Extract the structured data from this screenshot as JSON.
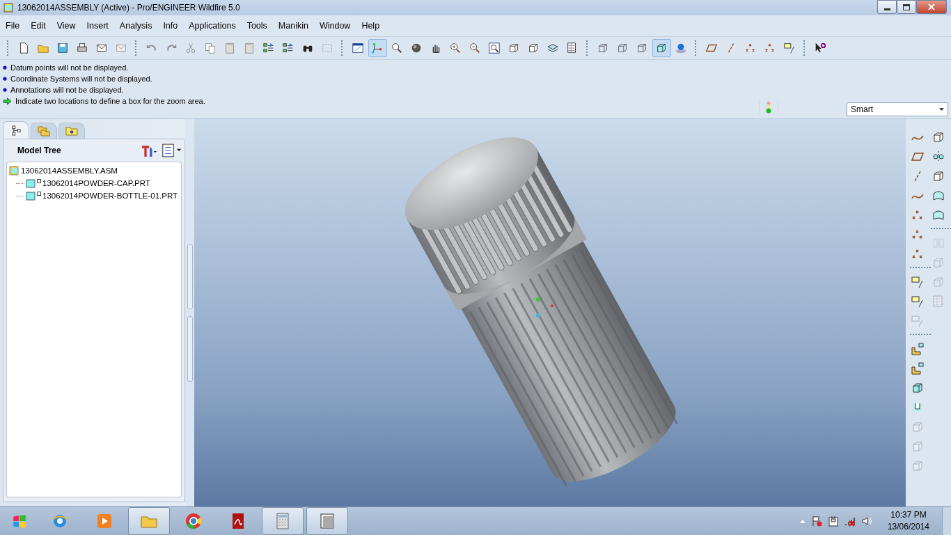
{
  "window": {
    "title": "13062014ASSEMBLY (Active) - Pro/ENGINEER Wildfire 5.0"
  },
  "menu": [
    "File",
    "Edit",
    "View",
    "Insert",
    "Analysis",
    "Info",
    "Applications",
    "Tools",
    "Manikin",
    "Window",
    "Help"
  ],
  "toolbar": [
    [
      {
        "kind": "page",
        "pressed": false
      },
      {
        "kind": "folder",
        "pressed": false
      },
      {
        "kind": "disk",
        "pressed": false
      },
      {
        "kind": "printer",
        "pressed": false
      },
      {
        "kind": "mail",
        "pressed": false
      },
      {
        "kind": "mail-grey",
        "pressed": false
      }
    ],
    [
      {
        "kind": "undo",
        "pressed": false
      },
      {
        "kind": "redo",
        "pressed": false
      },
      {
        "kind": "scissors",
        "pressed": false
      },
      {
        "kind": "copy",
        "pressed": false
      },
      {
        "kind": "clipboard",
        "pressed": false
      },
      {
        "kind": "clipboard",
        "pressed": false
      },
      {
        "kind": "list-arrows",
        "pressed": false
      },
      {
        "kind": "list-arrows",
        "pressed": false
      },
      {
        "kind": "binoculars",
        "pressed": false
      },
      {
        "kind": "dashed-box",
        "pressed": false
      }
    ],
    [
      {
        "kind": "window",
        "pressed": false
      },
      {
        "kind": "nodes",
        "pressed": true
      },
      {
        "kind": "magnifier",
        "pressed": false
      },
      {
        "kind": "sphere",
        "pressed": false
      },
      {
        "kind": "hand",
        "pressed": false
      },
      {
        "kind": "zoom-in",
        "pressed": false
      },
      {
        "kind": "zoom-out",
        "pressed": false
      },
      {
        "kind": "zoom-fit",
        "pressed": false
      },
      {
        "kind": "cube",
        "pressed": false
      },
      {
        "kind": "cube",
        "pressed": false
      },
      {
        "kind": "layers",
        "pressed": false
      },
      {
        "kind": "table",
        "pressed": false
      }
    ],
    [
      {
        "kind": "wire-cube",
        "pressed": false
      },
      {
        "kind": "wire-cube",
        "pressed": false
      },
      {
        "kind": "wire-cube",
        "pressed": false
      },
      {
        "kind": "shaded-cube",
        "pressed": true
      },
      {
        "kind": "globe",
        "pressed": false
      }
    ],
    [
      {
        "kind": "plane",
        "pressed": false
      },
      {
        "kind": "axis",
        "pressed": false
      },
      {
        "kind": "points",
        "pressed": false
      },
      {
        "kind": "points",
        "pressed": false
      },
      {
        "kind": "note",
        "pressed": false
      }
    ],
    [
      {
        "kind": "help",
        "pressed": false
      }
    ]
  ],
  "messages": [
    {
      "kind": "info",
      "text": "Datum points will not be displayed."
    },
    {
      "kind": "info",
      "text": "Coordinate Systems will not be displayed."
    },
    {
      "kind": "info",
      "text": "Annotations will not be displayed."
    },
    {
      "kind": "prompt",
      "text": "Indicate two locations to define a box for the zoom area."
    }
  ],
  "filter": {
    "value": "Smart"
  },
  "panel_tabs": [
    {
      "kind": "tree",
      "selected": true
    },
    {
      "kind": "folders",
      "selected": false
    },
    {
      "kind": "star-folder",
      "selected": false
    }
  ],
  "model_tree": {
    "title": "Model Tree",
    "items": [
      {
        "label": "13062014ASSEMBLY.ASM",
        "kind": "assembly",
        "children": [
          {
            "label": "13062014POWDER-CAP.PRT",
            "kind": "part"
          },
          {
            "label": "13062014POWDER-BOTTLE-01.PRT",
            "kind": "part"
          }
        ]
      }
    ]
  },
  "right_toolbar": [
    [
      {
        "kind": "curve",
        "disabled": false
      },
      {
        "kind": "plane",
        "disabled": false
      },
      {
        "kind": "axis",
        "disabled": false
      },
      {
        "kind": "curve",
        "disabled": false
      },
      {
        "kind": "points",
        "disabled": false
      },
      {
        "kind": "points",
        "disabled": false
      },
      {
        "kind": "points",
        "disabled": false
      },
      {
        "kind": "separator"
      },
      {
        "kind": "note",
        "disabled": false
      },
      {
        "kind": "note",
        "disabled": false
      },
      {
        "kind": "note",
        "disabled": true
      },
      {
        "kind": "separator"
      },
      {
        "kind": "component",
        "disabled": false
      },
      {
        "kind": "component",
        "disabled": false
      },
      {
        "kind": "shaded-cube",
        "disabled": false
      },
      {
        "kind": "cut",
        "disabled": false
      },
      {
        "kind": "cube",
        "disabled": true
      },
      {
        "kind": "cube",
        "disabled": true
      },
      {
        "kind": "cube",
        "disabled": true
      }
    ],
    [
      {
        "kind": "cube",
        "disabled": false
      },
      {
        "kind": "revolve",
        "disabled": false
      },
      {
        "kind": "cube",
        "disabled": false
      },
      {
        "kind": "surface",
        "disabled": false
      },
      {
        "kind": "surface",
        "disabled": false
      },
      {
        "kind": "separator"
      },
      {
        "kind": "mirror",
        "disabled": true
      },
      {
        "kind": "wire-cube",
        "disabled": true
      },
      {
        "kind": "wire-cube",
        "disabled": true
      },
      {
        "kind": "table",
        "disabled": true
      }
    ]
  ],
  "taskbar": [
    {
      "kind": "ie",
      "selected": false
    },
    {
      "kind": "media",
      "selected": false
    },
    {
      "kind": "explorer",
      "selected": true
    },
    {
      "kind": "chrome",
      "selected": false
    },
    {
      "kind": "pdf",
      "selected": false
    },
    {
      "kind": "calculator",
      "selected": true
    },
    {
      "kind": "proe",
      "selected": true
    }
  ],
  "clock": {
    "time": "10:37 PM",
    "date": "13/06/2014"
  }
}
